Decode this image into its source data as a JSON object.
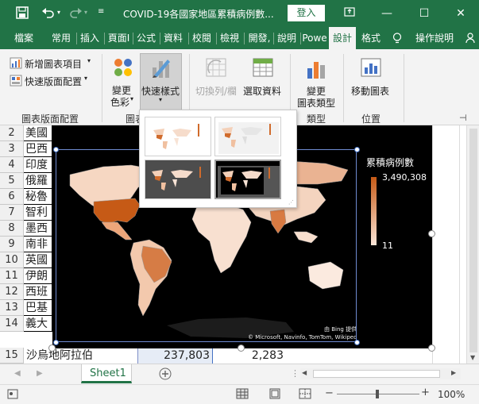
{
  "titlebar": {
    "doc_title": "COVID-19各國家地區累積病例數...",
    "login": "登入",
    "bg_color": "#217346"
  },
  "tabs": [
    {
      "label": "檔案"
    },
    {
      "label": "常用"
    },
    {
      "label": "插入"
    },
    {
      "label": "頁面I"
    },
    {
      "label": "公式"
    },
    {
      "label": "資料"
    },
    {
      "label": "校閱"
    },
    {
      "label": "檢視"
    },
    {
      "label": "開發,"
    },
    {
      "label": "說明"
    },
    {
      "label": "Powe"
    },
    {
      "label": "設計"
    },
    {
      "label": "格式"
    },
    {
      "label": "操作說明"
    }
  ],
  "ribbon": {
    "add_chart_element": "新增圖表項目",
    "quick_layout": "快速版面配置",
    "change_colors_line1": "變更",
    "change_colors_line2": "色彩",
    "quick_styles": "快速樣式",
    "switch_row_col": "切換列/欄",
    "select_data": "選取資料",
    "change_type_line1": "變更",
    "change_type_line2": "圖表類型",
    "move_chart": "移動圖表",
    "groups": {
      "layout": "圖表版面配置",
      "styles": "圖表",
      "type": "類型",
      "location": "位置"
    }
  },
  "rows": [
    {
      "num": "2",
      "name": "美國"
    },
    {
      "num": "3",
      "name": "巴西"
    },
    {
      "num": "4",
      "name": "印度"
    },
    {
      "num": "5",
      "name": "俄羅"
    },
    {
      "num": "6",
      "name": "秘魯"
    },
    {
      "num": "7",
      "name": "智利"
    },
    {
      "num": "8",
      "name": "墨西"
    },
    {
      "num": "9",
      "name": "南非"
    },
    {
      "num": "10",
      "name": "英國"
    },
    {
      "num": "11",
      "name": "伊朗"
    },
    {
      "num": "12",
      "name": "西班"
    },
    {
      "num": "13",
      "name": "巴基"
    },
    {
      "num": "14",
      "name": "義大"
    },
    {
      "num": "15",
      "name": "沙烏地阿拉伯",
      "b": "237,803",
      "c": "2,283"
    }
  ],
  "chart": {
    "legend_title": "累積病例數",
    "legend_max": "3,490,308",
    "legend_min": "11",
    "credit_line1": "由 Bing 提供",
    "credit_line2": "© Microsoft, Navinfo, TomTom, Wikipedia"
  },
  "sheet_tab": "Sheet1",
  "status": {
    "zoom": "100%"
  }
}
